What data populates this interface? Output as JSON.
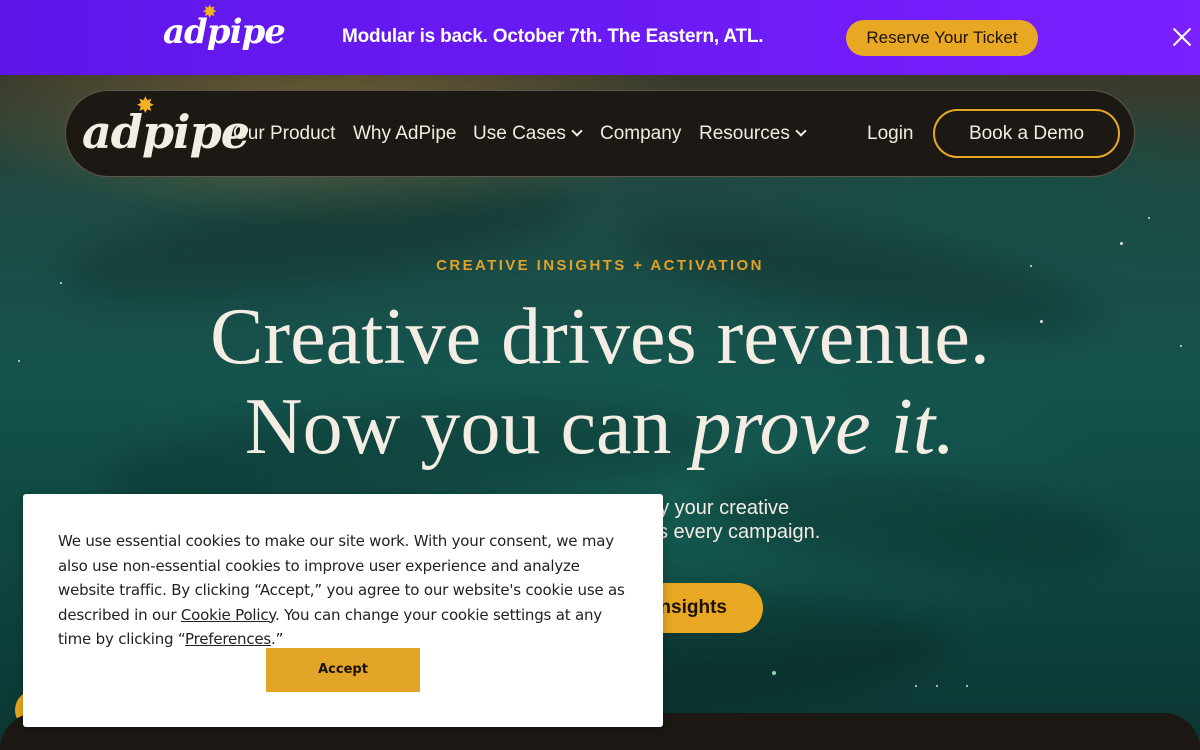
{
  "announcement": {
    "logo_text": "adpipe",
    "message": "Modular is back. October 7th. The Eastern, ATL.",
    "ticket_button": "Reserve Your Ticket"
  },
  "nav": {
    "logo_text": "adpipe",
    "items": [
      {
        "label": "Our Product"
      },
      {
        "label": "Why AdPipe"
      },
      {
        "label": "Use Cases"
      },
      {
        "label": "Company"
      },
      {
        "label": "Resources"
      }
    ],
    "login": "Login",
    "demo_button": "Book a Demo"
  },
  "hero": {
    "eyebrow": "CREATIVE INSIGHTS + ACTIVATION",
    "headline_line1": "Creative drives revenue.",
    "headline_line2_plain": "Now you can ",
    "headline_line2_italic": "prove it.",
    "subtext_line1": "ay your creative",
    "subtext_line2": "ss every campaign.",
    "cta_partial": "insights"
  },
  "cookie": {
    "text_part1": "We use essential cookies to make our site work. With your consent, we may also use non-essential cookies to improve user experience and analyze website traffic. By clicking “Accept,” you agree to our website's cookie use as described in our ",
    "cookie_policy_link": "Cookie Policy",
    "text_part2": ". You can change your cookie settings at any time by clicking “",
    "preferences_link": "Preferences",
    "text_part3": ".”",
    "accept_button": "Accept"
  },
  "colors": {
    "announcement_bg": "#6a1af3",
    "accent": "#e9a823",
    "nav_bg": "#1c1814",
    "text_light": "#f3ede4"
  }
}
